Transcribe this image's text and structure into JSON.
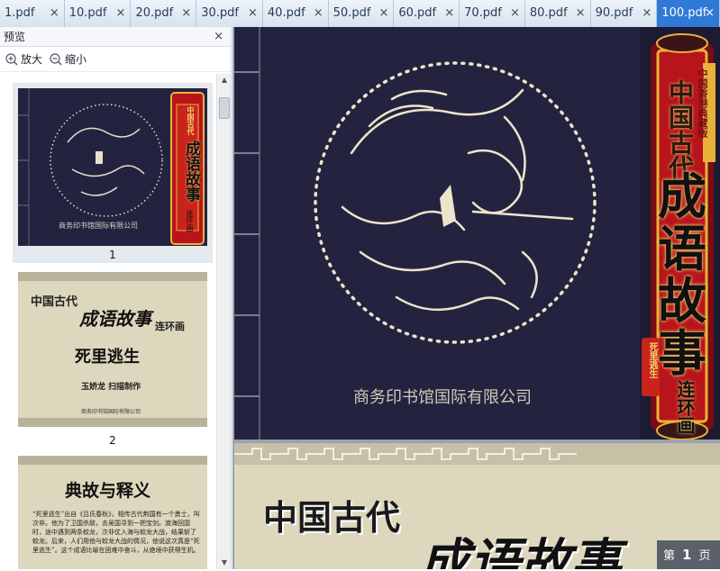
{
  "tabs": [
    {
      "label": "1.pdf",
      "active": false
    },
    {
      "label": "10.pdf",
      "active": false
    },
    {
      "label": "20.pdf",
      "active": false
    },
    {
      "label": "30.pdf",
      "active": false
    },
    {
      "label": "40.pdf",
      "active": false
    },
    {
      "label": "50.pdf",
      "active": false
    },
    {
      "label": "60.pdf",
      "active": false
    },
    {
      "label": "70.pdf",
      "active": false
    },
    {
      "label": "80.pdf",
      "active": false
    },
    {
      "label": "90.pdf",
      "active": false
    },
    {
      "label": "100.pdf",
      "active": true
    }
  ],
  "tab_close_glyph": "×",
  "preview": {
    "title": "预览",
    "close_glyph": "×",
    "zoom_in_label": "放大",
    "zoom_out_label": "缩小"
  },
  "thumbnails": [
    {
      "page": "1",
      "publisher": "商务印书馆国际有限公司",
      "series": "中国古代",
      "title_chars": "成语故事",
      "sub": "连环画",
      "side": "死里逃生"
    },
    {
      "page": "2",
      "series": "中国古代",
      "title": "成语故事",
      "sub": "连环画",
      "story": "死里逃生",
      "credit": "玉娇龙 扫描制作",
      "publisher": "商务印书馆国际有限公司"
    },
    {
      "page": "3",
      "heading": "典故与释义",
      "body": "“死里逃生”出自《吕氏春秋》，相传古代荆国有一个勇士，叫次非。他为了卫国杀敌，去吴国寻到一把宝剑。渡海回国时，途中遇到两条蛟龙，次非仗入海与蛟龙大战，结果斩了蛟龙。后来，人们用他与蛟龙大战的情况，他说这次真是“死里逃生”。这个成语比喻在困难中奋斗，从绝境中获得生机。"
    }
  ],
  "main_page1": {
    "publisher": "商务印书馆国际有限公司",
    "badge": "中国香港典藏版",
    "series": "中国古代",
    "title_chars": [
      "成",
      "语",
      "故",
      "事"
    ],
    "sub": "连环画",
    "side": "死里逃生"
  },
  "main_page2": {
    "series": "中国古代",
    "title": "成语故事"
  },
  "page_indicator": {
    "prefix": "第",
    "current": "1",
    "suffix": "页"
  },
  "colors": {
    "active_tab": "#2f7ad6",
    "cover_bg": "#24233f",
    "banner_red": "#b8141c",
    "banner_gold": "#e7b33a",
    "parchment": "#ddd7bd"
  }
}
